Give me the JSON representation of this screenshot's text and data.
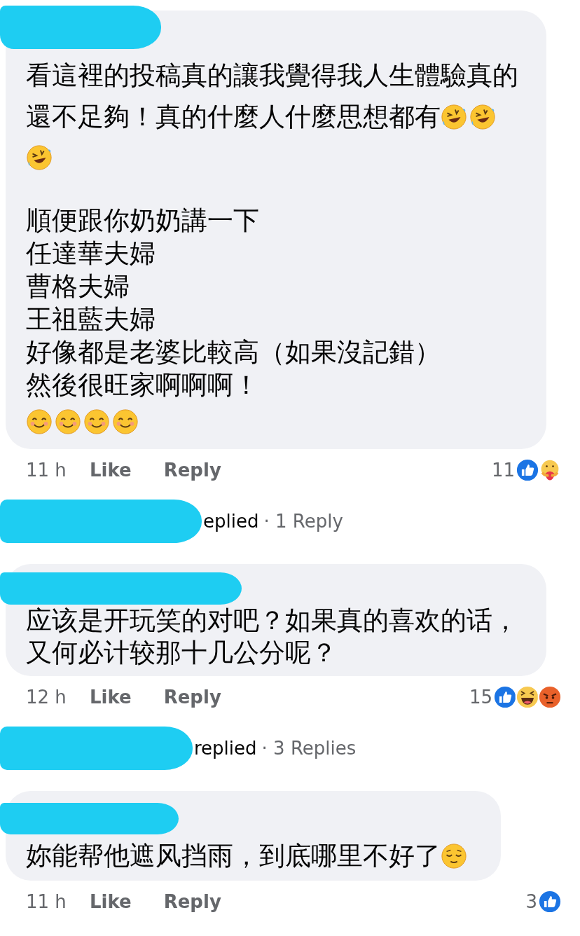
{
  "comments": [
    {
      "paragraphs": [
        [
          {
            "text": "看這裡的投稿真的讓我覺得我人生體驗真的"
          },
          {
            "text": "還不足夠！真的什麼人什麼思想都有",
            "emoji": [
              {
                "kind": "rofl"
              },
              {
                "kind": "rofl"
              }
            ]
          },
          {
            "emoji": [
              {
                "kind": "rofl"
              }
            ]
          }
        ],
        [
          {
            "text": "順便跟你奶奶講一下"
          },
          {
            "text": "任達華夫婦"
          },
          {
            "text": "曹格夫婦"
          },
          {
            "text": "王祖藍夫婦"
          },
          {
            "text": "好像都是老婆比較高（如果沒記錯）"
          },
          {
            "text": "然後很旺家啊啊啊！"
          },
          {
            "emoji": [
              {
                "kind": "smile"
              },
              {
                "kind": "smile"
              },
              {
                "kind": "smile"
              },
              {
                "kind": "smile"
              }
            ]
          }
        ]
      ],
      "time": "11 h",
      "actions": [
        "Like",
        "Reply"
      ],
      "reactions": {
        "count": "11",
        "icons": [
          {
            "kind": "like"
          },
          {
            "kind": "care"
          }
        ]
      },
      "replies": {
        "text": "eplied",
        "count": "· 1 Reply"
      }
    },
    {
      "paragraphs": [
        [
          {
            "text": "应该是开玩笑的对吧？如果真的喜欢的话，"
          },
          {
            "text": "又何必计较那十几公分呢？"
          }
        ]
      ],
      "time": "12 h",
      "actions": [
        "Like",
        "Reply"
      ],
      "reactions": {
        "count": "15",
        "icons": [
          {
            "kind": "like"
          },
          {
            "kind": "haha"
          },
          {
            "kind": "angry"
          }
        ]
      },
      "replies": {
        "text": "replied",
        "count": "· 3 Replies"
      }
    },
    {
      "paragraphs": [
        [
          {
            "text": "妳能帮他遮风挡雨，到底哪里不好了",
            "emoji": [
              {
                "kind": "relieved"
              }
            ]
          }
        ]
      ],
      "time": "11 h",
      "actions": [
        "Like",
        "Reply"
      ],
      "reactions": {
        "count": "3",
        "icons": [
          {
            "kind": "like"
          }
        ]
      }
    }
  ]
}
